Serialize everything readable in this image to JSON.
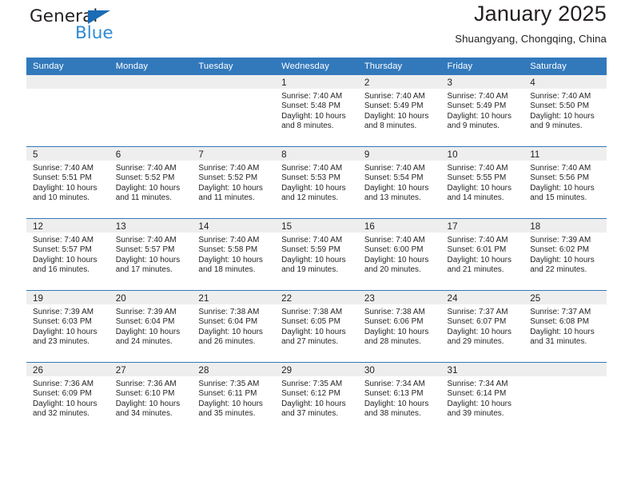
{
  "brand": {
    "name_part1": "General",
    "name_part2": "Blue",
    "triangle_color": "#1a6cb5",
    "blue_color": "#2e8bd4"
  },
  "header": {
    "title": "January 2025",
    "subtitle": "Shuangyang, Chongqing, China"
  },
  "theme": {
    "header_bg": "#3279bc",
    "daynum_bg": "#eeeeee",
    "row_divider": "#3279bc",
    "text": "#231f20"
  },
  "weekday_headers": [
    "Sunday",
    "Monday",
    "Tuesday",
    "Wednesday",
    "Thursday",
    "Friday",
    "Saturday"
  ],
  "weeks": [
    [
      {
        "day": "",
        "sunrise": "",
        "sunset": "",
        "daylight": ""
      },
      {
        "day": "",
        "sunrise": "",
        "sunset": "",
        "daylight": ""
      },
      {
        "day": "",
        "sunrise": "",
        "sunset": "",
        "daylight": ""
      },
      {
        "day": "1",
        "sunrise": "Sunrise: 7:40 AM",
        "sunset": "Sunset: 5:48 PM",
        "daylight": "Daylight: 10 hours and 8 minutes."
      },
      {
        "day": "2",
        "sunrise": "Sunrise: 7:40 AM",
        "sunset": "Sunset: 5:49 PM",
        "daylight": "Daylight: 10 hours and 8 minutes."
      },
      {
        "day": "3",
        "sunrise": "Sunrise: 7:40 AM",
        "sunset": "Sunset: 5:49 PM",
        "daylight": "Daylight: 10 hours and 9 minutes."
      },
      {
        "day": "4",
        "sunrise": "Sunrise: 7:40 AM",
        "sunset": "Sunset: 5:50 PM",
        "daylight": "Daylight: 10 hours and 9 minutes."
      }
    ],
    [
      {
        "day": "5",
        "sunrise": "Sunrise: 7:40 AM",
        "sunset": "Sunset: 5:51 PM",
        "daylight": "Daylight: 10 hours and 10 minutes."
      },
      {
        "day": "6",
        "sunrise": "Sunrise: 7:40 AM",
        "sunset": "Sunset: 5:52 PM",
        "daylight": "Daylight: 10 hours and 11 minutes."
      },
      {
        "day": "7",
        "sunrise": "Sunrise: 7:40 AM",
        "sunset": "Sunset: 5:52 PM",
        "daylight": "Daylight: 10 hours and 11 minutes."
      },
      {
        "day": "8",
        "sunrise": "Sunrise: 7:40 AM",
        "sunset": "Sunset: 5:53 PM",
        "daylight": "Daylight: 10 hours and 12 minutes."
      },
      {
        "day": "9",
        "sunrise": "Sunrise: 7:40 AM",
        "sunset": "Sunset: 5:54 PM",
        "daylight": "Daylight: 10 hours and 13 minutes."
      },
      {
        "day": "10",
        "sunrise": "Sunrise: 7:40 AM",
        "sunset": "Sunset: 5:55 PM",
        "daylight": "Daylight: 10 hours and 14 minutes."
      },
      {
        "day": "11",
        "sunrise": "Sunrise: 7:40 AM",
        "sunset": "Sunset: 5:56 PM",
        "daylight": "Daylight: 10 hours and 15 minutes."
      }
    ],
    [
      {
        "day": "12",
        "sunrise": "Sunrise: 7:40 AM",
        "sunset": "Sunset: 5:57 PM",
        "daylight": "Daylight: 10 hours and 16 minutes."
      },
      {
        "day": "13",
        "sunrise": "Sunrise: 7:40 AM",
        "sunset": "Sunset: 5:57 PM",
        "daylight": "Daylight: 10 hours and 17 minutes."
      },
      {
        "day": "14",
        "sunrise": "Sunrise: 7:40 AM",
        "sunset": "Sunset: 5:58 PM",
        "daylight": "Daylight: 10 hours and 18 minutes."
      },
      {
        "day": "15",
        "sunrise": "Sunrise: 7:40 AM",
        "sunset": "Sunset: 5:59 PM",
        "daylight": "Daylight: 10 hours and 19 minutes."
      },
      {
        "day": "16",
        "sunrise": "Sunrise: 7:40 AM",
        "sunset": "Sunset: 6:00 PM",
        "daylight": "Daylight: 10 hours and 20 minutes."
      },
      {
        "day": "17",
        "sunrise": "Sunrise: 7:40 AM",
        "sunset": "Sunset: 6:01 PM",
        "daylight": "Daylight: 10 hours and 21 minutes."
      },
      {
        "day": "18",
        "sunrise": "Sunrise: 7:39 AM",
        "sunset": "Sunset: 6:02 PM",
        "daylight": "Daylight: 10 hours and 22 minutes."
      }
    ],
    [
      {
        "day": "19",
        "sunrise": "Sunrise: 7:39 AM",
        "sunset": "Sunset: 6:03 PM",
        "daylight": "Daylight: 10 hours and 23 minutes."
      },
      {
        "day": "20",
        "sunrise": "Sunrise: 7:39 AM",
        "sunset": "Sunset: 6:04 PM",
        "daylight": "Daylight: 10 hours and 24 minutes."
      },
      {
        "day": "21",
        "sunrise": "Sunrise: 7:38 AM",
        "sunset": "Sunset: 6:04 PM",
        "daylight": "Daylight: 10 hours and 26 minutes."
      },
      {
        "day": "22",
        "sunrise": "Sunrise: 7:38 AM",
        "sunset": "Sunset: 6:05 PM",
        "daylight": "Daylight: 10 hours and 27 minutes."
      },
      {
        "day": "23",
        "sunrise": "Sunrise: 7:38 AM",
        "sunset": "Sunset: 6:06 PM",
        "daylight": "Daylight: 10 hours and 28 minutes."
      },
      {
        "day": "24",
        "sunrise": "Sunrise: 7:37 AM",
        "sunset": "Sunset: 6:07 PM",
        "daylight": "Daylight: 10 hours and 29 minutes."
      },
      {
        "day": "25",
        "sunrise": "Sunrise: 7:37 AM",
        "sunset": "Sunset: 6:08 PM",
        "daylight": "Daylight: 10 hours and 31 minutes."
      }
    ],
    [
      {
        "day": "26",
        "sunrise": "Sunrise: 7:36 AM",
        "sunset": "Sunset: 6:09 PM",
        "daylight": "Daylight: 10 hours and 32 minutes."
      },
      {
        "day": "27",
        "sunrise": "Sunrise: 7:36 AM",
        "sunset": "Sunset: 6:10 PM",
        "daylight": "Daylight: 10 hours and 34 minutes."
      },
      {
        "day": "28",
        "sunrise": "Sunrise: 7:35 AM",
        "sunset": "Sunset: 6:11 PM",
        "daylight": "Daylight: 10 hours and 35 minutes."
      },
      {
        "day": "29",
        "sunrise": "Sunrise: 7:35 AM",
        "sunset": "Sunset: 6:12 PM",
        "daylight": "Daylight: 10 hours and 37 minutes."
      },
      {
        "day": "30",
        "sunrise": "Sunrise: 7:34 AM",
        "sunset": "Sunset: 6:13 PM",
        "daylight": "Daylight: 10 hours and 38 minutes."
      },
      {
        "day": "31",
        "sunrise": "Sunrise: 7:34 AM",
        "sunset": "Sunset: 6:14 PM",
        "daylight": "Daylight: 10 hours and 39 minutes."
      },
      {
        "day": "",
        "sunrise": "",
        "sunset": "",
        "daylight": ""
      }
    ]
  ]
}
